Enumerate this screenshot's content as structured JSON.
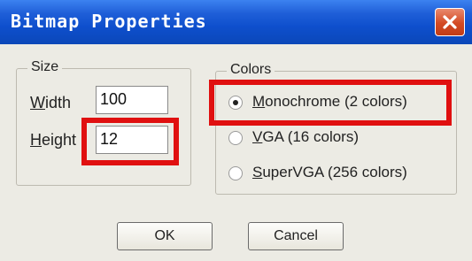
{
  "window": {
    "title": "Bitmap Properties"
  },
  "size_group": {
    "legend": "Size",
    "width": {
      "label_accel": "W",
      "label_rest": "idth",
      "value": "100"
    },
    "height": {
      "label_accel": "H",
      "label_rest": "eight",
      "value": "12"
    }
  },
  "colors_group": {
    "legend": "Colors",
    "options": [
      {
        "accel": "M",
        "rest": "onochrome (2 colors)",
        "selected": true
      },
      {
        "accel": "V",
        "rest": "GA (16 colors)",
        "selected": false
      },
      {
        "accel": "S",
        "rest": "uperVGA (256 colors)",
        "selected": false
      }
    ]
  },
  "buttons": {
    "ok": "OK",
    "cancel": "Cancel"
  },
  "colors": {
    "highlight": "#e01010",
    "titlebar": "#0e4fcd"
  }
}
